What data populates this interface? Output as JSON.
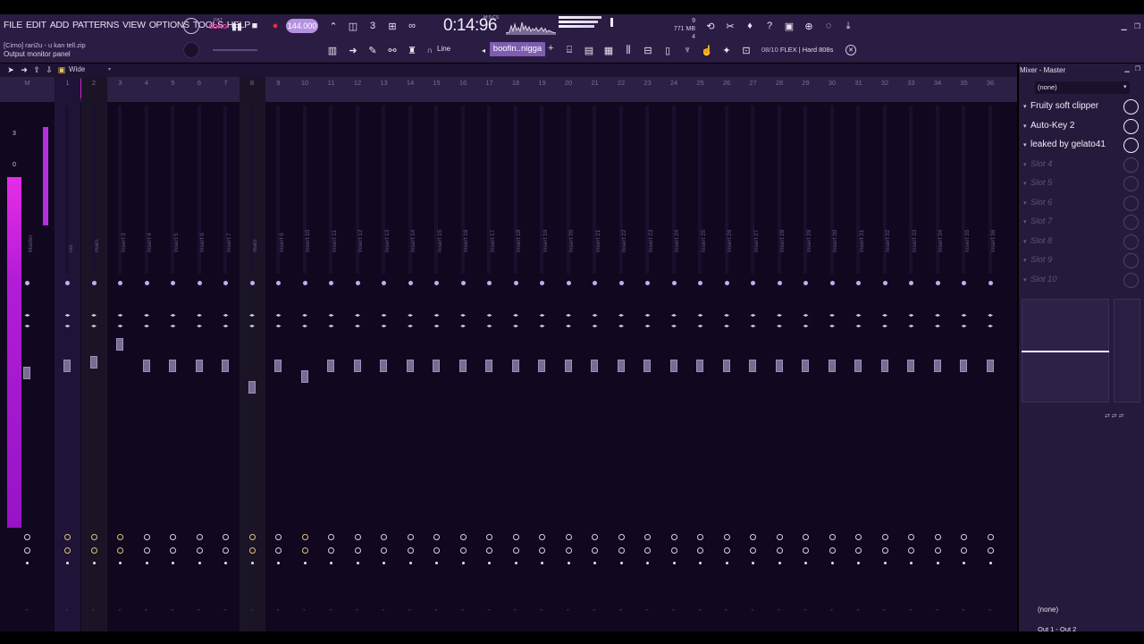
{
  "menu": [
    "FILE",
    "EDIT",
    "ADD",
    "PATTERNS",
    "VIEW",
    "OPTIONS",
    "TOOLS",
    "HELP"
  ],
  "hint": {
    "file": "[Cirno] rari2u - u kan tell.zip",
    "text": "Output monitor panel"
  },
  "transport": {
    "mode_top": "PAT",
    "mode": "SONG",
    "tempo": "144.000",
    "time": "0:14:96",
    "time_label": "M:S:CS"
  },
  "memory": {
    "value": "771 MB",
    "polyphony": "4",
    "cpu": "9"
  },
  "toolbar": {
    "snap": "Line",
    "pattern": "boofin..nigga",
    "news": "08/10",
    "news_text": "FLEX | Hard 808s"
  },
  "mixer_view": "Wide",
  "mixer_numbers": [
    "M",
    "1",
    "2",
    "3",
    "4",
    "5",
    "6",
    "7",
    "8",
    "9",
    "10",
    "11",
    "12",
    "13",
    "14",
    "15",
    "16",
    "17",
    "18",
    "19",
    "20",
    "21",
    "22",
    "23",
    "24",
    "25",
    "26",
    "27",
    "28",
    "29",
    "30",
    "31",
    "32",
    "33",
    "34",
    "35",
    "36"
  ],
  "mixer_names": [
    "Master",
    "rec",
    "main",
    "Insert 3",
    "Insert 4",
    "Insert 5",
    "Insert 6",
    "Insert 7",
    "main",
    "Insert 9",
    "Insert 10",
    "Insert 11",
    "Insert 12",
    "Insert 13",
    "Insert 14",
    "Insert 15",
    "Insert 16",
    "Insert 17",
    "Insert 18",
    "Insert 19",
    "Insert 20",
    "Insert 21",
    "Insert 22",
    "Insert 23",
    "Insert 24",
    "Insert 25",
    "Insert 26",
    "Insert 27",
    "Insert 28",
    "Insert 29",
    "Insert 30",
    "Insert 31",
    "Insert 32",
    "Insert 33",
    "Insert 34",
    "Insert 35",
    "Insert 36"
  ],
  "master_scale": [
    "3",
    "0"
  ],
  "mixer_panel": {
    "title": "Mixer - Master",
    "input": "(none)",
    "slots": [
      {
        "label": "Fruity soft clipper",
        "empty": false
      },
      {
        "label": "Auto-Key 2",
        "empty": false
      },
      {
        "label": "leaked by gelato41",
        "empty": false
      },
      {
        "label": "Slot 4",
        "empty": true
      },
      {
        "label": "Slot 5",
        "empty": true
      },
      {
        "label": "Slot 6",
        "empty": true
      },
      {
        "label": "Slot 7",
        "empty": true
      },
      {
        "label": "Slot 8",
        "empty": true
      },
      {
        "label": "Slot 9",
        "empty": true
      },
      {
        "label": "Slot 10",
        "empty": true
      }
    ],
    "output_none": "(none)",
    "output": "Out 1 - Out 2"
  },
  "colors": {
    "accent": "#d71fd6",
    "panel": "#2a1c43",
    "mixer_bg": "#11081f",
    "tempo": "#b591e0"
  }
}
